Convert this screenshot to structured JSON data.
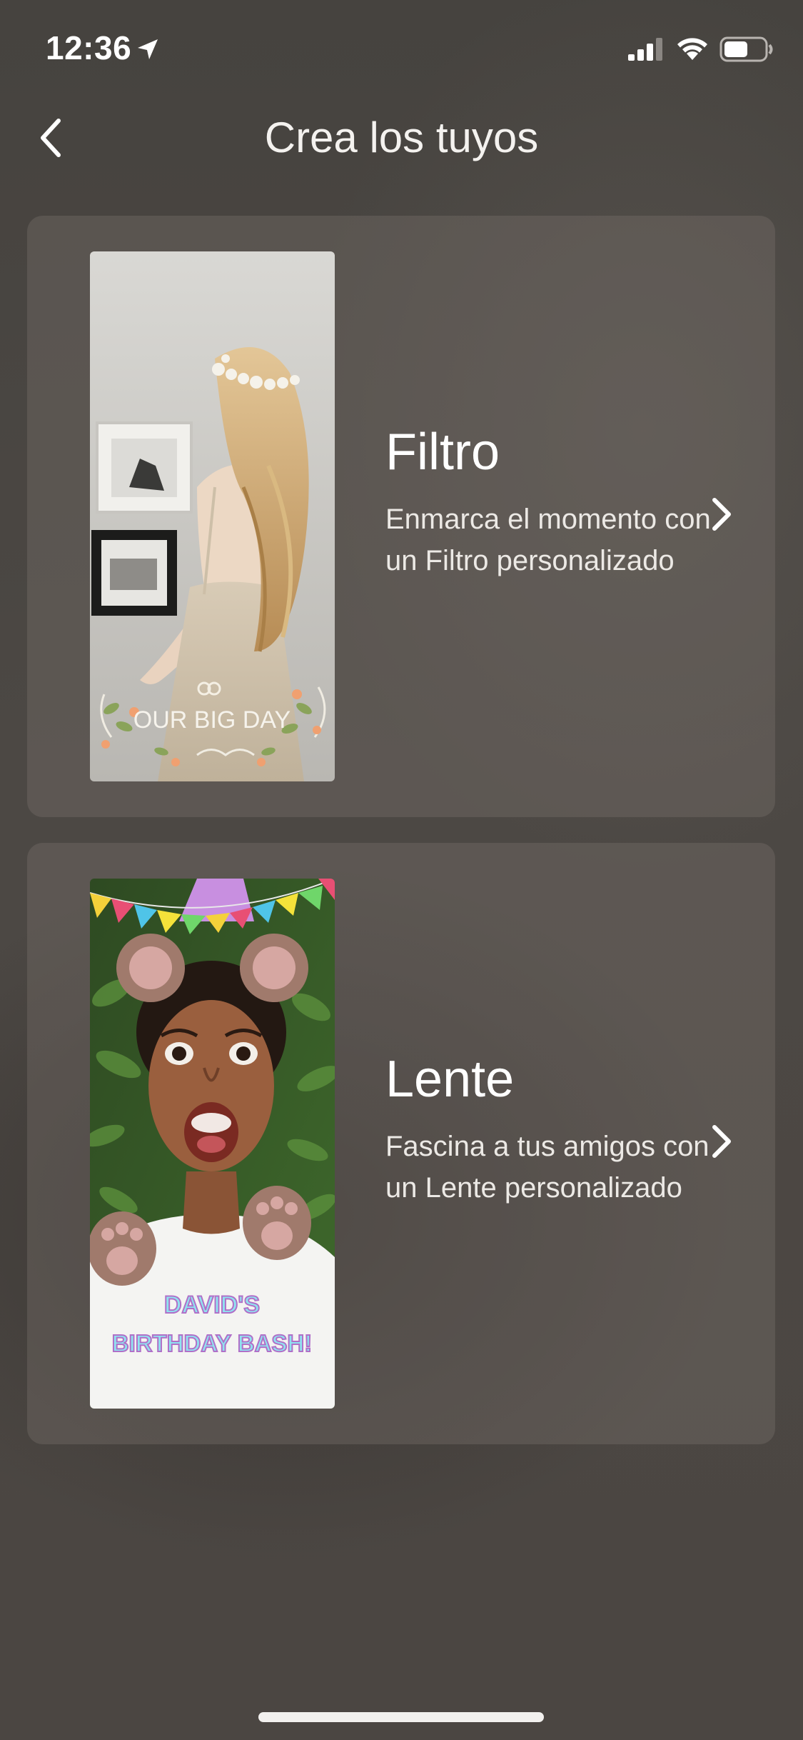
{
  "status_bar": {
    "time": "12:36",
    "icons": [
      "location-arrow-icon",
      "cellular-signal-icon",
      "wifi-icon",
      "battery-icon"
    ]
  },
  "header": {
    "back_icon": "chevron-left-icon",
    "title": "Crea los tuyos"
  },
  "cards": [
    {
      "title": "Filtro",
      "description": "Enmarca el momento con un Filtro personalizado",
      "thumbnail_caption": "OUR BIG DAY",
      "chevron_icon": "chevron-right-icon"
    },
    {
      "title": "Lente",
      "description": "Fascina a tus amigos con un Lente personalizado",
      "thumbnail_caption_line1": "DAVID'S",
      "thumbnail_caption_line2": "BIRTHDAY BASH!",
      "chevron_icon": "chevron-right-icon"
    }
  ],
  "colors": {
    "background": "#4a4643",
    "card": "#6e6964",
    "text": "#ffffff",
    "lens_caption_fill": "#8fe3f0",
    "lens_caption_outline": "#b070c8"
  }
}
